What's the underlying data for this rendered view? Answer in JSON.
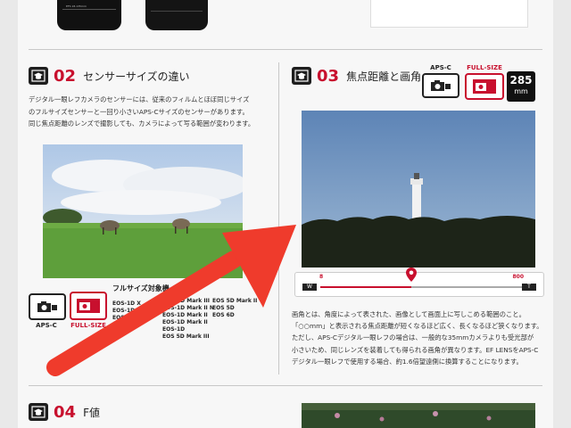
{
  "section02": {
    "number": "02",
    "title": "センサーサイズの違い",
    "body": [
      "デジタル一眼レフカメラのセンサーには、従来のフィルムとほぼ同じサイズ",
      "のフルサイズセンサーと一回り小さいAPS-Cサイズのセンサーがあります。",
      "同じ焦点距離のレンズで撮影しても、カメラによって写る範囲が変わります。"
    ],
    "apsc_label": "APS-C",
    "fullsize_label": "FULL-SIZE",
    "models_heading": "フルサイズ対象機",
    "models_col1": [
      "EOS-1D X",
      "EOS-1Ds Mark III",
      "EOS-1D",
      "EOS"
    ],
    "models_col2": [
      "EOS-1D Mark III",
      "EOS-1D Mark II N",
      "EOS-1D Mark II",
      "EOS-1D Mark II",
      "EOS-1D",
      "EOS 5D Mark III"
    ],
    "models_col3": [
      "EOS 5D Mark II",
      "EOS 5D",
      "EOS 6D"
    ]
  },
  "section03": {
    "number": "03",
    "title": "焦点距離と画角",
    "apsc_label": "APS-C",
    "fullsize_label": "FULL-SIZE",
    "focal_value": "285",
    "focal_unit": "mm",
    "slider_min": "8",
    "slider_max": "800",
    "slider_left_cap": "W",
    "slider_right_cap": "T",
    "slider_level_fraction": 0.45,
    "body": [
      "画角とは、角度によって表された、画像として画面上に写しこめる範囲のこと。",
      "「○○mm」と表示される焦点距離が短くなるほど広く、長くなるほど狭くなります。",
      "ただし、APS-Cデジタル一眼レフの場合は、一般的な35mmカメラよりも受光部が",
      "小さいため、同じレンズを装着しても得られる画角が異なります。EF LENSをAPS-C",
      "デジタル一眼レフで使用する場合、約1.6倍望遠側に換算することになります。"
    ]
  },
  "section04": {
    "number": "04",
    "title": "F値"
  },
  "colors": {
    "accent": "#c8102e",
    "arrow": "#ef3b2c"
  }
}
